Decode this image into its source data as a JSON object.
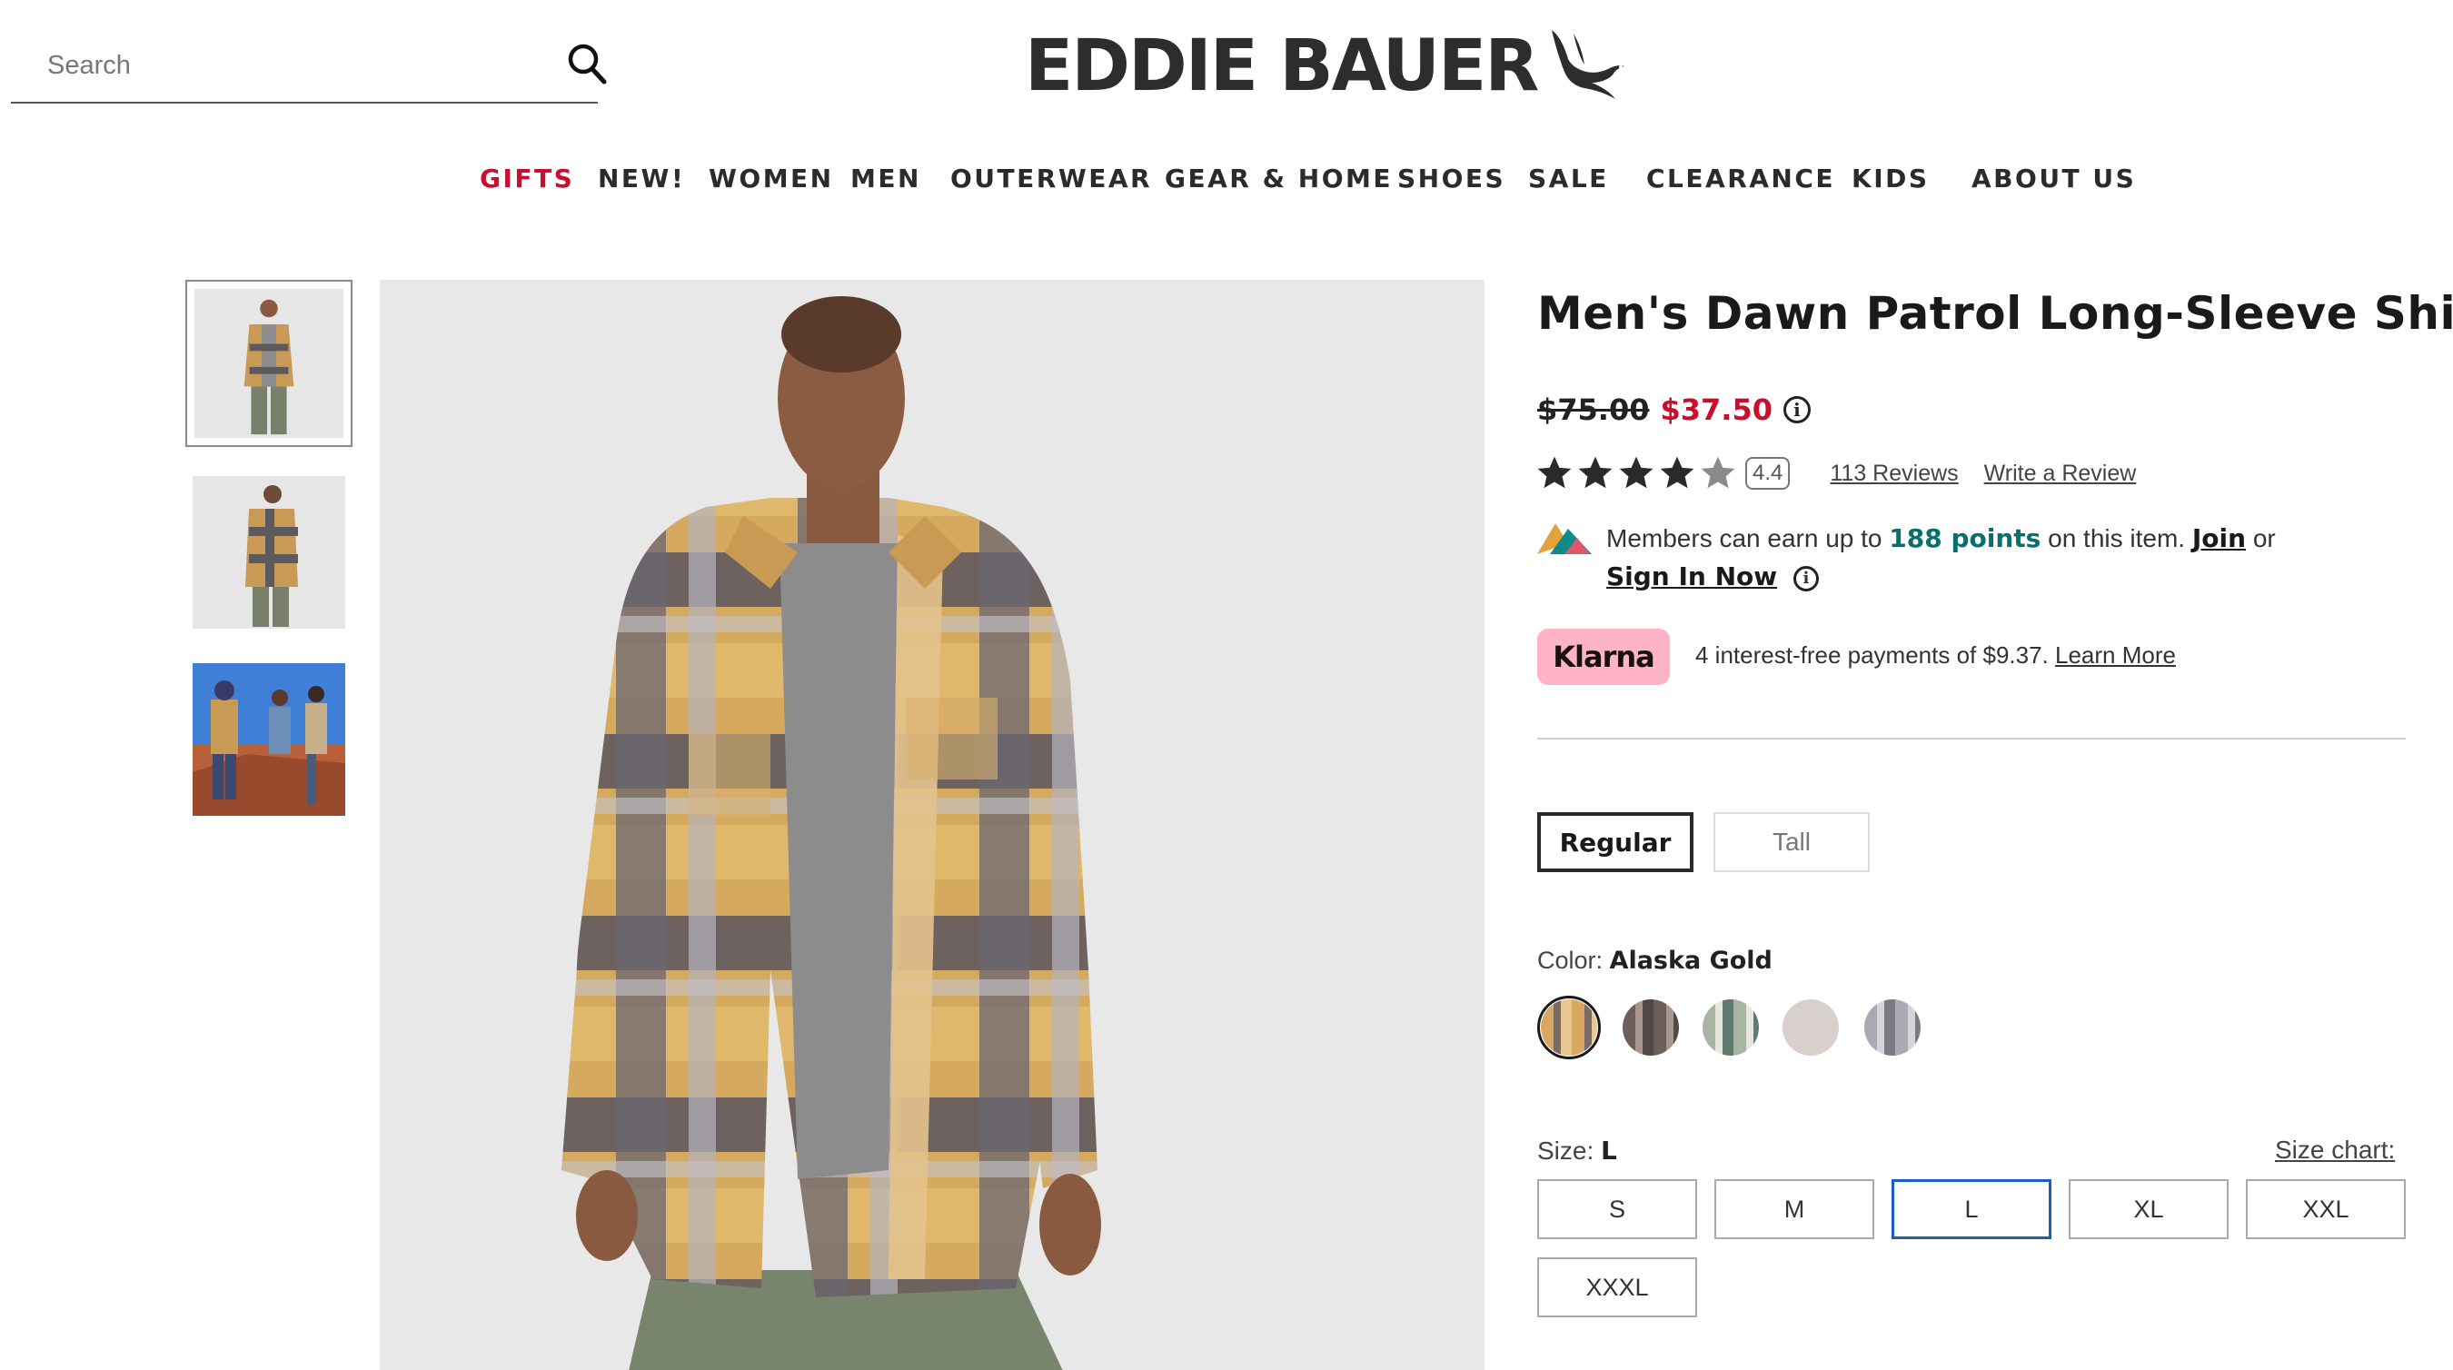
{
  "search": {
    "placeholder": "Search"
  },
  "brand": {
    "name": "EDDIE BAUER"
  },
  "nav": {
    "items": [
      {
        "label": "GIFTS",
        "highlight": true
      },
      {
        "label": "NEW!"
      },
      {
        "label": "WOMEN"
      },
      {
        "label": "MEN"
      },
      {
        "label": "OUTERWEAR"
      },
      {
        "label": "GEAR & HOME"
      },
      {
        "label": "SHOES"
      },
      {
        "label": "SALE"
      },
      {
        "label": "CLEARANCE"
      },
      {
        "label": "KIDS"
      },
      {
        "label": "ABOUT US"
      }
    ]
  },
  "product": {
    "title": "Men's Dawn Patrol Long-Sleeve Shirt",
    "price_original": "$75.00",
    "price_sale": "$37.50",
    "rating": 4.4,
    "rating_text": "4.4",
    "reviews_link": "113 Reviews",
    "write_review": "Write a Review"
  },
  "rewards": {
    "text_before": "Members can earn up to",
    "points": "188 points",
    "text_after": "on this item.",
    "join": "Join",
    "or": "or",
    "sign_in": "Sign In Now"
  },
  "klarna": {
    "logo": "Klarna",
    "text": "4 interest-free payments of $9.37.",
    "learn_more": "Learn More"
  },
  "fit": {
    "options": [
      "Regular",
      "Tall"
    ],
    "selected": "Regular"
  },
  "color": {
    "label": "Color:",
    "selected": "Alaska Gold",
    "swatches": [
      {
        "name": "alaska-gold",
        "color": "#c8935a"
      },
      {
        "name": "plaid-2",
        "color": "#6d5e5a"
      },
      {
        "name": "plaid-3",
        "color": "#a8b4a4"
      },
      {
        "name": "plaid-4",
        "color": "#d8d0cc"
      },
      {
        "name": "plaid-5",
        "color": "#a9aab3"
      }
    ]
  },
  "size": {
    "label": "Size:",
    "selected": "L",
    "chart_link": "Size chart:",
    "options": [
      "S",
      "M",
      "L",
      "XL",
      "XXL",
      "XXXL"
    ]
  },
  "colors": {
    "accent_red": "#c8102e",
    "teal": "#086f6f",
    "klarna_pink": "#ffb3c7",
    "selected_blue": "#1a5fc8"
  }
}
